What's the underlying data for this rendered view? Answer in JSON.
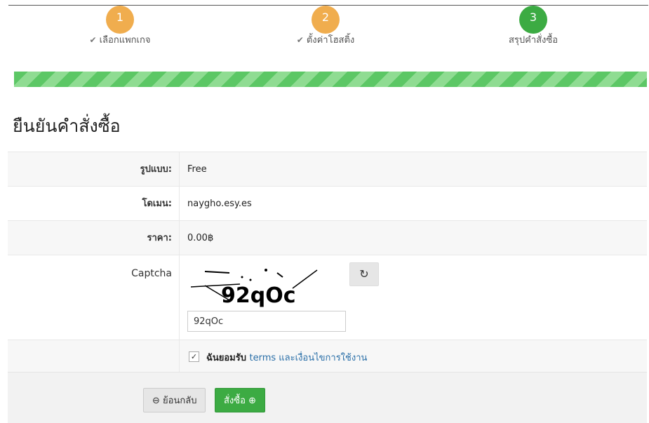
{
  "steps": [
    {
      "number": "1",
      "label": "เลือกแพกเกจ",
      "done": true,
      "color": "#f0ad4e"
    },
    {
      "number": "2",
      "label": "ตั้งค่าโฮสติ้ง",
      "done": true,
      "color": "#f0ad4e"
    },
    {
      "number": "3",
      "label": "สรุปคำสั่งซื้อ",
      "done": false,
      "color": "#3cab43"
    }
  ],
  "page_title": "ยืนยันคำสั่งซื้อ",
  "summary": {
    "plan_label": "รูปแบบ:",
    "plan_value": "Free",
    "domain_label": "โดเมน:",
    "domain_value": "naygho.esy.es",
    "price_label": "ราคา:",
    "price_value": "0.00฿",
    "captcha_label": "Captcha",
    "captcha_input_value": "92qOc",
    "refresh_icon": "refresh-icon"
  },
  "terms": {
    "prefix": "ฉันยอมรับ",
    "link": "terms และเงื่อนไขการใช้งาน",
    "checked": true
  },
  "buttons": {
    "back": "ย้อนกลับ",
    "order": "สั่งซื้อ"
  }
}
